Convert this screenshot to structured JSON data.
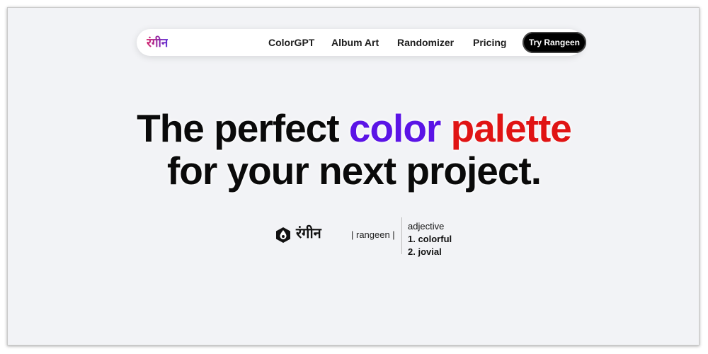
{
  "nav": {
    "brand": "रंगीन",
    "links": [
      "ColorGPT",
      "Album Art",
      "Randomizer",
      "Pricing"
    ],
    "cta": "Try Rangeen"
  },
  "hero": {
    "line1_part1": "The perfect ",
    "line1_color": "color",
    "line1_palette": "palette",
    "line2": "for your next project."
  },
  "definition": {
    "icon": "palette-drop-icon",
    "word": "रंगीन",
    "romanization": "| rangeen |",
    "part_of_speech": "adjective",
    "meanings": [
      "1. colorful",
      "2. jovial"
    ]
  },
  "colors": {
    "accent_purple": "#5b14e6",
    "accent_red": "#e01414",
    "background": "#f2f3f6"
  }
}
